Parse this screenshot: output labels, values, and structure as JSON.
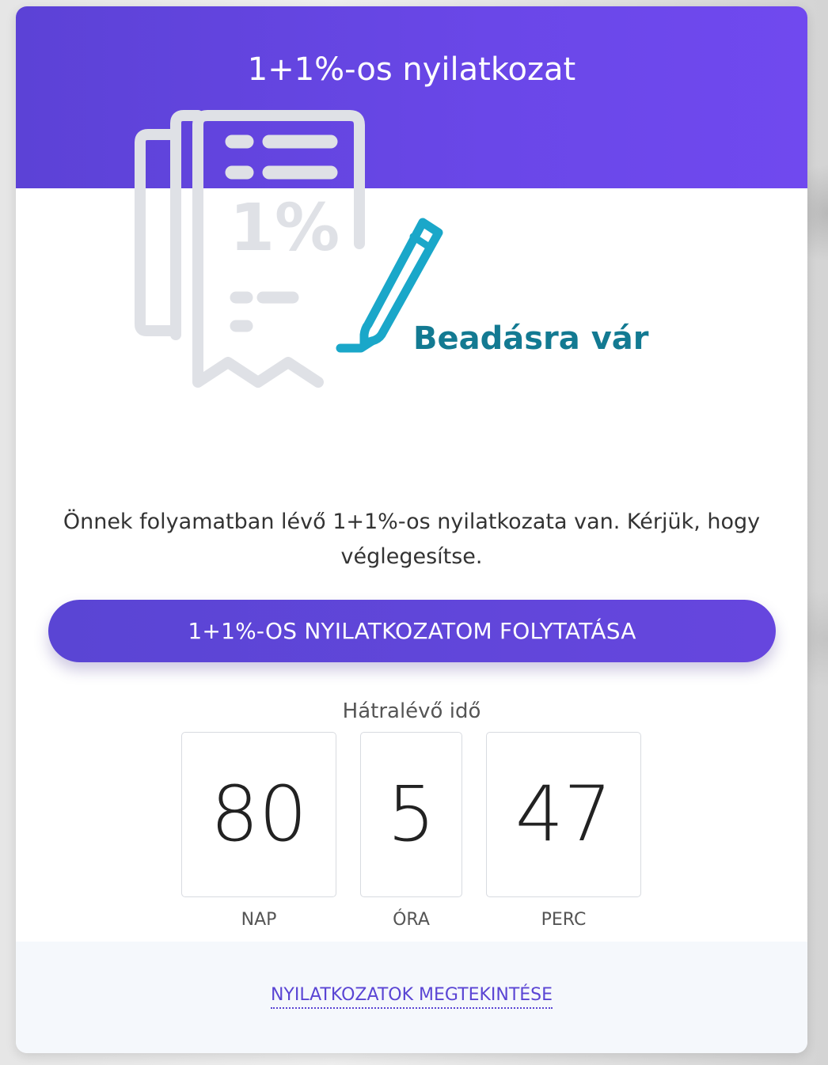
{
  "card": {
    "title": "1+1%-os nyilatkozat",
    "status": "Beadásra vár",
    "illustration_icon": "document-percent-pencil-icon",
    "message": "Önnek folyamatban lévő 1+1%-os nyilatkozata van. Kérjük, hogy véglegesítse.",
    "cta_label": "1+1%-OS NYILATKOZATOM FOLYTATÁSA"
  },
  "countdown": {
    "label": "Hátralévő idő",
    "days": {
      "value": "80",
      "unit": "NAP"
    },
    "hours": {
      "value": "5",
      "unit": "ÓRA"
    },
    "minutes": {
      "value": "47",
      "unit": "PERC"
    }
  },
  "footer": {
    "link_label": "NYILATKOZATOK MEGTEKINTÉSE"
  },
  "colors": {
    "header": "#6a47e8",
    "status": "#137a92",
    "pencil": "#1aa7c9",
    "document": "#dfe1e6"
  }
}
